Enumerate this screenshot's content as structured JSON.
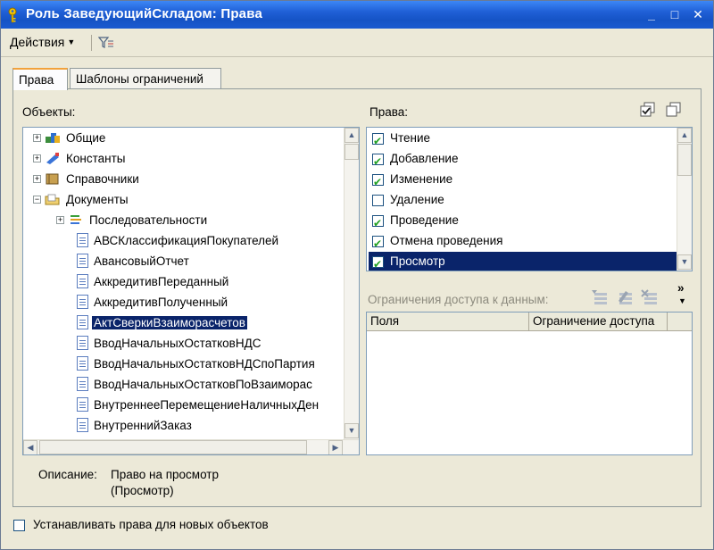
{
  "window": {
    "title": "Роль ЗаведующийСкладом: Права",
    "minimize": "_",
    "maximize": "□",
    "close": "✕"
  },
  "toolbar": {
    "actions_label": "Действия",
    "actions_caret": "▼"
  },
  "tabs": [
    {
      "label": "Права",
      "active": true
    },
    {
      "label": "Шаблоны ограничений",
      "active": false
    }
  ],
  "objects_panel": {
    "label": "Объекты:",
    "items": [
      {
        "label": "Общие",
        "expander": "+"
      },
      {
        "label": "Константы",
        "expander": "+"
      },
      {
        "label": "Справочники",
        "expander": "+"
      },
      {
        "label": "Документы",
        "expander": "−"
      },
      {
        "label": "Последовательности",
        "expander": "+"
      },
      {
        "label": "АВСКлассификацияПокупателей"
      },
      {
        "label": "АвансовыйОтчет"
      },
      {
        "label": "АккредитивПереданный"
      },
      {
        "label": "АккредитивПолученный"
      },
      {
        "label": "АктСверкиВзаиморасчетов",
        "selected": true
      },
      {
        "label": "ВводНачальныхОстатковНДС"
      },
      {
        "label": "ВводНачальныхОстатковНДСпоПартия"
      },
      {
        "label": "ВводНачальныхОстатковПоВзаиморас"
      },
      {
        "label": "ВнутреннееПеремещениеНаличныхДен"
      },
      {
        "label": "ВнутреннийЗаказ"
      }
    ]
  },
  "rights_panel": {
    "label": "Права:",
    "items": [
      {
        "label": "Чтение",
        "checked": true
      },
      {
        "label": "Добавление",
        "checked": true
      },
      {
        "label": "Изменение",
        "checked": true
      },
      {
        "label": "Удаление",
        "checked": false
      },
      {
        "label": "Проведение",
        "checked": true
      },
      {
        "label": "Отмена проведения",
        "checked": true
      },
      {
        "label": "Просмотр",
        "checked": true,
        "selected": true
      }
    ]
  },
  "restrictions": {
    "label": "Ограничения доступа к данным:",
    "more": "»",
    "columns": [
      "Поля",
      "Ограничение доступа"
    ]
  },
  "description": {
    "label": "Описание:",
    "line1": "Право на просмотр",
    "line2": "(Просмотр)"
  },
  "new_objects": {
    "label": "Устанавливать права для новых объектов",
    "checked": false
  },
  "colors": {
    "titlebar": "#1f5fd6",
    "selection": "#0a246a",
    "window_bg": "#ece9d8"
  }
}
